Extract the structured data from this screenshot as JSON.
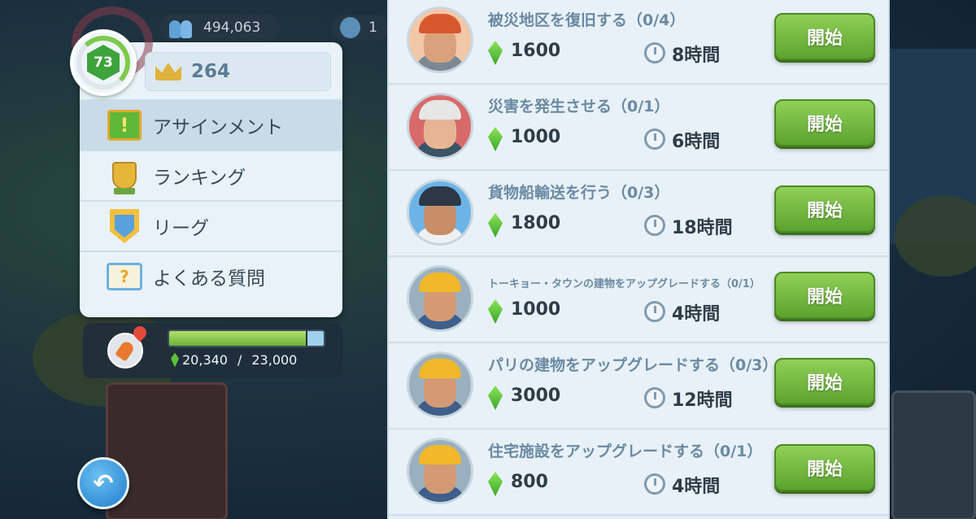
{
  "top_stats": {
    "population": "494,063",
    "coins": "1"
  },
  "profile": {
    "level": "73",
    "gold": "264"
  },
  "menu": {
    "items": [
      {
        "label": "アサインメント",
        "icon": "assignment-icon",
        "active": true
      },
      {
        "label": "ランキング",
        "icon": "trophy-icon",
        "active": false
      },
      {
        "label": "リーグ",
        "icon": "league-shield-icon",
        "active": false
      },
      {
        "label": "よくある質問",
        "icon": "faq-book-icon",
        "active": false
      }
    ]
  },
  "progress": {
    "current": "20,340",
    "separator": "/",
    "max": "23,000",
    "fraction": 0.884
  },
  "tasks": [
    {
      "title": "被災地区を復旧する（0/4）",
      "reward": "1600",
      "duration": "8時間",
      "button": "開始",
      "avatar": "miner",
      "small": false
    },
    {
      "title": "災害を発生させる（0/1）",
      "reward": "1000",
      "duration": "6時間",
      "button": "開始",
      "avatar": "scientist",
      "small": false
    },
    {
      "title": "貨物船輸送を行う（0/3）",
      "reward": "1800",
      "duration": "18時間",
      "button": "開始",
      "avatar": "captain",
      "small": false
    },
    {
      "title": "トーキョー・タウンの建物をアップグレードする（0/1）",
      "reward": "1000",
      "duration": "4時間",
      "button": "開始",
      "avatar": "builder",
      "small": true
    },
    {
      "title": "パリの建物をアップグレードする（0/3）",
      "reward": "3000",
      "duration": "12時間",
      "button": "開始",
      "avatar": "builder",
      "small": false
    },
    {
      "title": "住宅施設をアップグレードする（0/1）",
      "reward": "800",
      "duration": "4時間",
      "button": "開始",
      "avatar": "builder",
      "small": false
    }
  ],
  "colors": {
    "start_button": "#6cb23a",
    "gem": "#5cc03a",
    "panel": "#e8f1f7"
  }
}
